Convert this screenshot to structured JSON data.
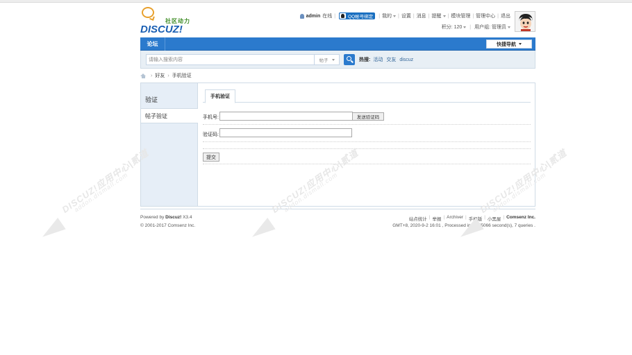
{
  "logo": {
    "cn": "社区动力",
    "en": "DISCUZ!"
  },
  "user": {
    "name": "admin",
    "status": "在线",
    "qq_bind": "QQ帐号绑定",
    "links": [
      "我的",
      "设置",
      "消息",
      "提醒",
      "模块管理",
      "管理中心",
      "退出"
    ],
    "points_label": "积分: 120",
    "group_label": "用户组: 管理员"
  },
  "nav": {
    "forum": "论坛",
    "quick_nav": "快捷导航"
  },
  "search": {
    "placeholder": "请输入搜索内容",
    "type": "帖子",
    "hot_label": "热搜:",
    "hot_items": [
      "活动",
      "交友",
      "discuz"
    ]
  },
  "breadcrumb": [
    "好友",
    "手机验证"
  ],
  "sidebar": {
    "title": "验证",
    "items": [
      "帖子验证"
    ]
  },
  "form": {
    "tab": "手机验证",
    "phone_label": "手机号:",
    "send_code": "发送验证码",
    "code_label": "验证码:",
    "submit": "提交"
  },
  "footer": {
    "powered_prefix": "Powered by",
    "powered_brand": "Discuz!",
    "version": "X3.4",
    "copyright": "© 2001-2017 Comsenz Inc.",
    "links": [
      "站点统计",
      "举报",
      "Archiver",
      "手机版",
      "小黑屋"
    ],
    "company": "Comsenz Inc.",
    "processed": "GMT+8, 2020-9-2 16:01 , Processed in 1.155066 second(s), 7 queries ."
  },
  "watermark": {
    "main": "DISCUZ!应用中心|贰道",
    "sub": "addon.dismall.com"
  }
}
